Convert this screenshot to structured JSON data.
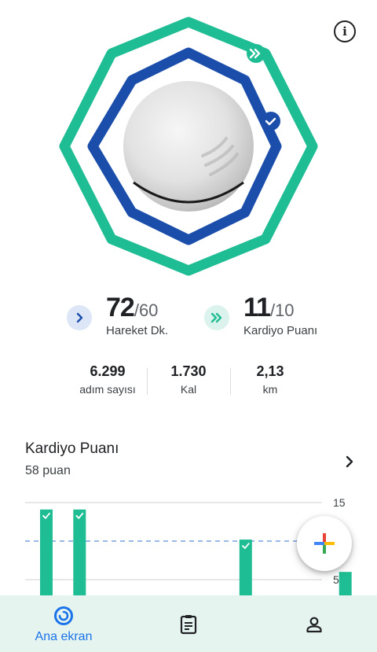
{
  "colors": {
    "heart_points_ring": "#1fbd93",
    "move_minutes_ring": "#1b4eab",
    "active_nav": "#1a73e8"
  },
  "icons": {
    "info": "info-icon",
    "move_minutes_badge": "chevron-right-icon",
    "heart_points_badge": "double-chevron-right-icon",
    "card_chevron": "chevron-right-icon",
    "fab": "plus-icon",
    "nav_home": "home-ring-icon",
    "nav_journal": "clipboard-icon",
    "nav_profile": "profile-icon"
  },
  "goals": {
    "move_minutes": {
      "value": "72",
      "goal": "/60",
      "label": "Hareket Dk."
    },
    "heart_points": {
      "value": "11",
      "goal": "/10",
      "label": "Kardiyo Puanı"
    }
  },
  "summary": [
    {
      "value": "6.299",
      "label": "adım sayısı"
    },
    {
      "value": "1.730",
      "label": "Kal"
    },
    {
      "value": "2,13",
      "label": "km"
    }
  ],
  "heart_card": {
    "title": "Kardiyo Puanı",
    "subtitle": "58 puan"
  },
  "chart_data": {
    "type": "bar",
    "y_ticks": [
      "15",
      "5"
    ],
    "ylim": [
      0,
      15
    ],
    "goal_line": 10,
    "values": [
      14.1,
      14.1,
      0,
      0,
      1.2,
      0,
      10.2,
      0,
      1.2,
      6
    ],
    "goal_met": [
      true,
      true,
      false,
      false,
      false,
      false,
      true,
      false,
      false,
      false
    ],
    "bar_color": "#1fbd93",
    "goal_line_color": "#5b8dd9"
  },
  "nav": {
    "home_label": "Ana ekran"
  }
}
